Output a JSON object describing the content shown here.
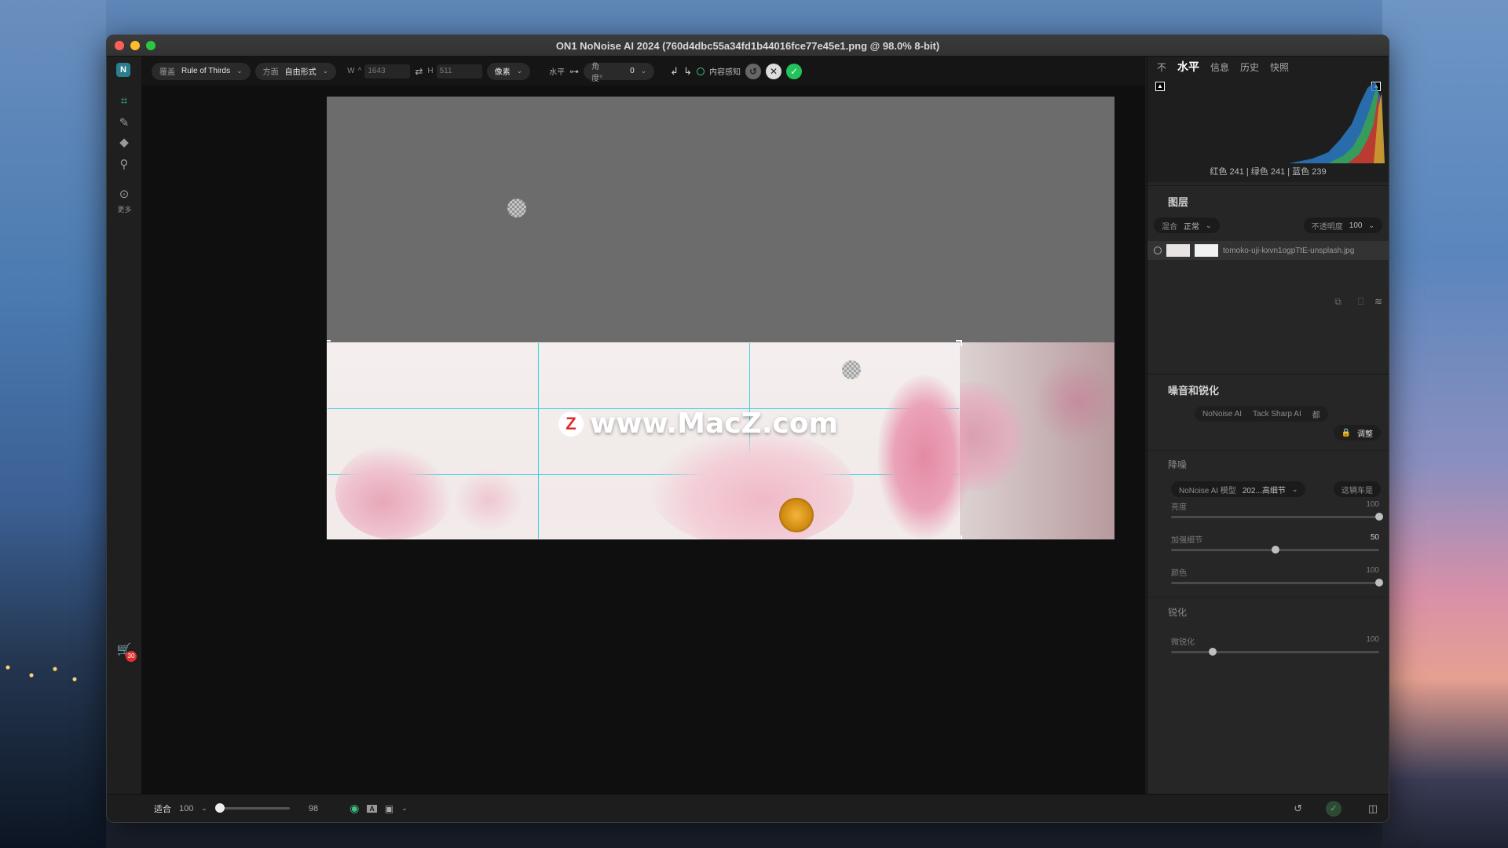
{
  "window": {
    "title": "ON1 NoNoise AI 2024 (760d4dbc55a34fd1b44016fce77e45e1.png @ 98.0% 8-bit)"
  },
  "toolbar": {
    "overlay_label": "覆盖",
    "overlay_value": "Rule of Thirds",
    "aspect_label": "方面",
    "aspect_value": "自由形式",
    "w_label": "W",
    "w_value": "1643",
    "h_label": "H",
    "h_value": "511",
    "unit_value": "像素",
    "level_label": "水平",
    "angle_label": "角度°",
    "angle_value": "0",
    "content_aware_label": "内容感知"
  },
  "left_tools": {
    "more_label": "更多",
    "cart_badge": "30"
  },
  "watermark": {
    "letter": "Z",
    "text": "www.MacZ.com"
  },
  "bottom": {
    "fit_label": "适合",
    "zoom_value": "100",
    "slider_value": "98"
  },
  "right": {
    "tabs": [
      "不",
      "水平",
      "信息",
      "历史",
      "快照"
    ],
    "histogram_readout": "红色 241 | 绿色 241 | 蓝色 239",
    "layers": {
      "title": "图层",
      "blend_label": "混合",
      "blend_value": "正常",
      "opacity_label": "不透明度",
      "opacity_value": "100",
      "layer_name": "tomoko-uji-kxvn1ogpTtE-unsplash.jpg"
    },
    "noise": {
      "title": "噪音和锐化",
      "tabs": [
        "NoNoise AI",
        "Tack Sharp AI",
        "都"
      ],
      "adjust_label": "调整",
      "denoise_title": "降噪",
      "model_label": "NoNoise AI 模型",
      "model_value": "202...高细节",
      "preset_label": "这辆车是",
      "params": [
        {
          "label": "亮度",
          "value": "100",
          "level": 1.0
        },
        {
          "label": "加强细节",
          "value": "50",
          "level": 0.5
        },
        {
          "label": "颜色",
          "value": "100",
          "level": 1.0
        }
      ],
      "sharpen_title": "锐化",
      "sharpen_params": [
        {
          "label": "微锐化",
          "value": "100",
          "level": 0.2
        }
      ]
    }
  }
}
